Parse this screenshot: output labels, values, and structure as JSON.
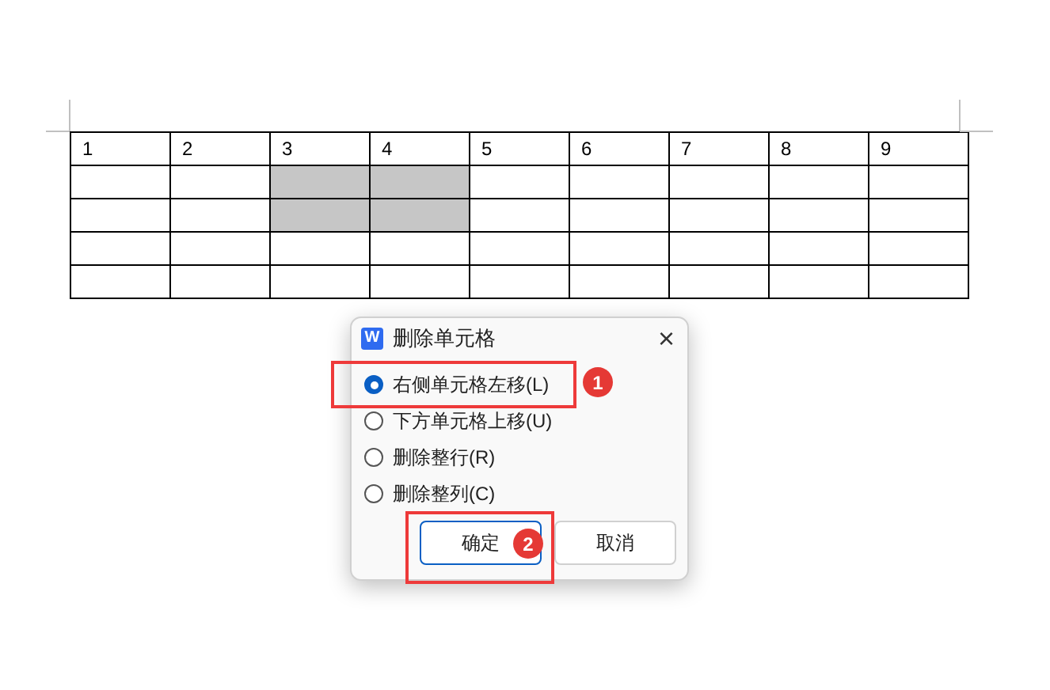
{
  "table": {
    "rows": [
      {
        "cells": [
          {
            "text": "1",
            "selected": false
          },
          {
            "text": "2",
            "selected": false
          },
          {
            "text": "3",
            "selected": false
          },
          {
            "text": "4",
            "selected": false
          },
          {
            "text": "5",
            "selected": false
          },
          {
            "text": "6",
            "selected": false
          },
          {
            "text": "7",
            "selected": false
          },
          {
            "text": "8",
            "selected": false
          },
          {
            "text": "9",
            "selected": false
          }
        ]
      },
      {
        "cells": [
          {
            "selected": false
          },
          {
            "selected": false
          },
          {
            "selected": true
          },
          {
            "selected": true
          },
          {
            "selected": false
          },
          {
            "selected": false
          },
          {
            "selected": false
          },
          {
            "selected": false
          },
          {
            "selected": false
          }
        ]
      },
      {
        "cells": [
          {
            "selected": false
          },
          {
            "selected": false
          },
          {
            "selected": true
          },
          {
            "selected": true
          },
          {
            "selected": false
          },
          {
            "selected": false
          },
          {
            "selected": false
          },
          {
            "selected": false
          },
          {
            "selected": false
          }
        ]
      },
      {
        "cells": [
          {
            "selected": false
          },
          {
            "selected": false
          },
          {
            "selected": false
          },
          {
            "selected": false
          },
          {
            "selected": false
          },
          {
            "selected": false
          },
          {
            "selected": false
          },
          {
            "selected": false
          },
          {
            "selected": false
          }
        ]
      },
      {
        "cells": [
          {
            "selected": false
          },
          {
            "selected": false
          },
          {
            "selected": false
          },
          {
            "selected": false
          },
          {
            "selected": false
          },
          {
            "selected": false
          },
          {
            "selected": false
          },
          {
            "selected": false
          },
          {
            "selected": false
          }
        ]
      }
    ]
  },
  "dialog": {
    "app_icon": "W",
    "title": "删除单元格",
    "close": "×",
    "options": [
      {
        "label": "右侧单元格左移(L)",
        "selected": true
      },
      {
        "label": "下方单元格上移(U)",
        "selected": false
      },
      {
        "label": "删除整行(R)",
        "selected": false
      },
      {
        "label": "删除整列(C)",
        "selected": false
      }
    ],
    "buttons": [
      {
        "label": "确定",
        "kind": "primary"
      },
      {
        "label": "取消",
        "kind": "secondary"
      }
    ]
  },
  "annotations": [
    {
      "label": "1",
      "kind": "option"
    },
    {
      "label": "2",
      "kind": "button"
    }
  ]
}
